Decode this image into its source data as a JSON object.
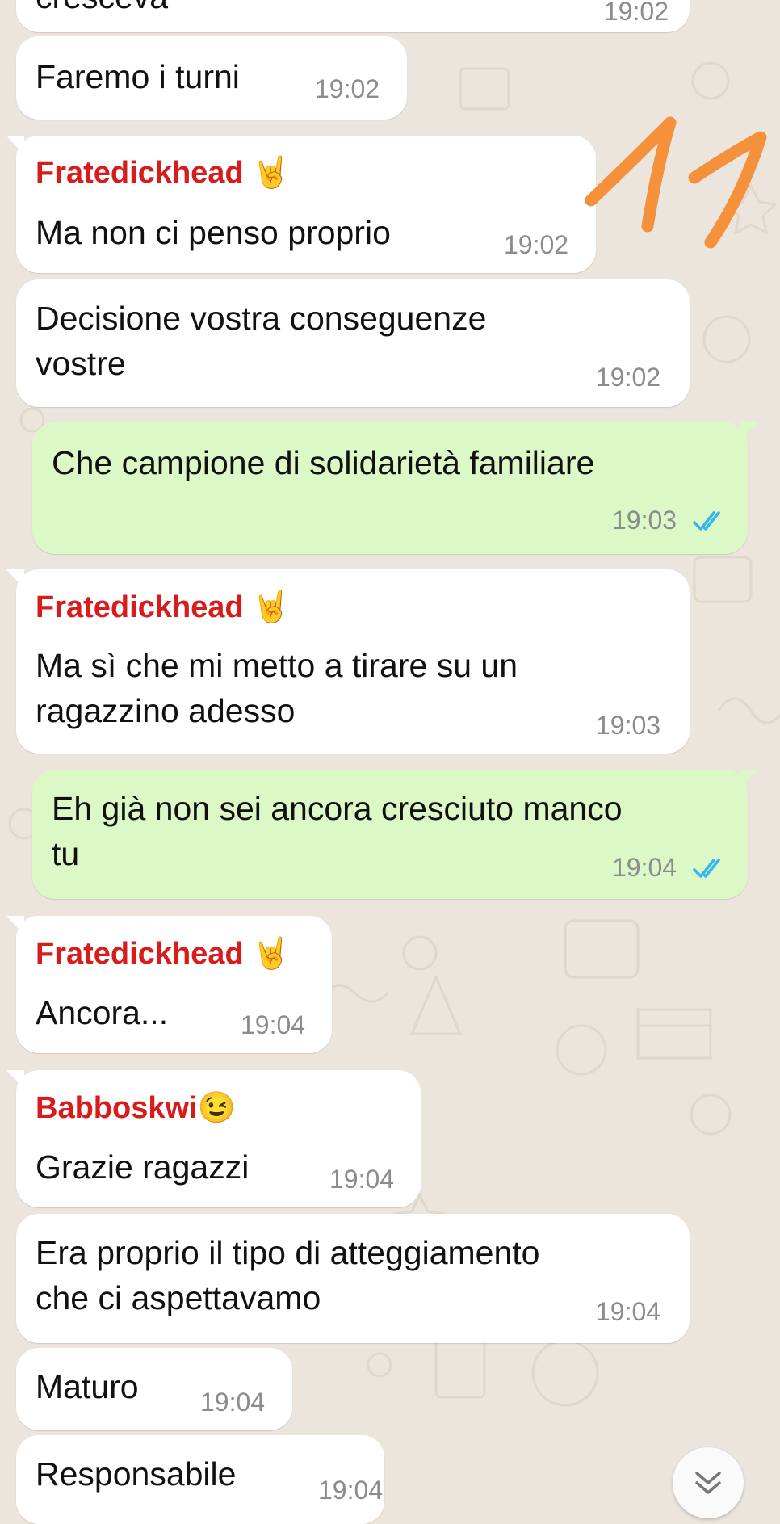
{
  "chat": {
    "top_partial": {
      "text": "cresceva",
      "time": "19:02"
    },
    "messages": [
      {
        "text": "Faremo i turni",
        "time": "19:02"
      },
      {
        "sender": "Fratedickhead",
        "sender_emoji": "🤘",
        "text": "Ma non ci penso proprio",
        "time": "19:02"
      },
      {
        "lines": [
          "Decisione vostra conseguenze",
          "vostre"
        ],
        "time": "19:02"
      },
      {
        "outgoing": true,
        "text": "Che campione di solidarietà familiare",
        "time": "19:03",
        "status": "read"
      },
      {
        "sender": "Fratedickhead",
        "sender_emoji": "🤘",
        "lines": [
          "Ma sì che mi metto a tirare su un",
          "ragazzino adesso"
        ],
        "time": "19:03"
      },
      {
        "outgoing": true,
        "lines": [
          "Eh già non sei ancora cresciuto manco",
          "tu"
        ],
        "time": "19:04",
        "status": "read"
      },
      {
        "sender": "Fratedickhead",
        "sender_emoji": "🤘",
        "text": "Ancora...",
        "time": "19:04"
      },
      {
        "sender": "Babboskwi",
        "sender_emoji": "😉",
        "text": "Grazie ragazzi",
        "time": "19:04"
      },
      {
        "lines": [
          "Era proprio il tipo di atteggiamento",
          "che ci aspettavamo"
        ],
        "time": "19:04"
      },
      {
        "text": "Maturo",
        "time": "19:04"
      },
      {
        "text": "Responsabile",
        "time": "19:04"
      }
    ]
  },
  "annotation_text": "11",
  "colors": {
    "incoming_bubble": "#ffffff",
    "outgoing_bubble": "#dcf8c6",
    "sender_name": "#d81b1b",
    "read_ticks": "#34b7f1",
    "annotation": "#f5913a"
  },
  "icons": {
    "scroll_down": "double-chevron-down-icon",
    "read_status": "double-check-icon",
    "sender_emoji_1": "sign-of-the-horns-emoji",
    "sender_emoji_2": "winking-face-emoji"
  }
}
